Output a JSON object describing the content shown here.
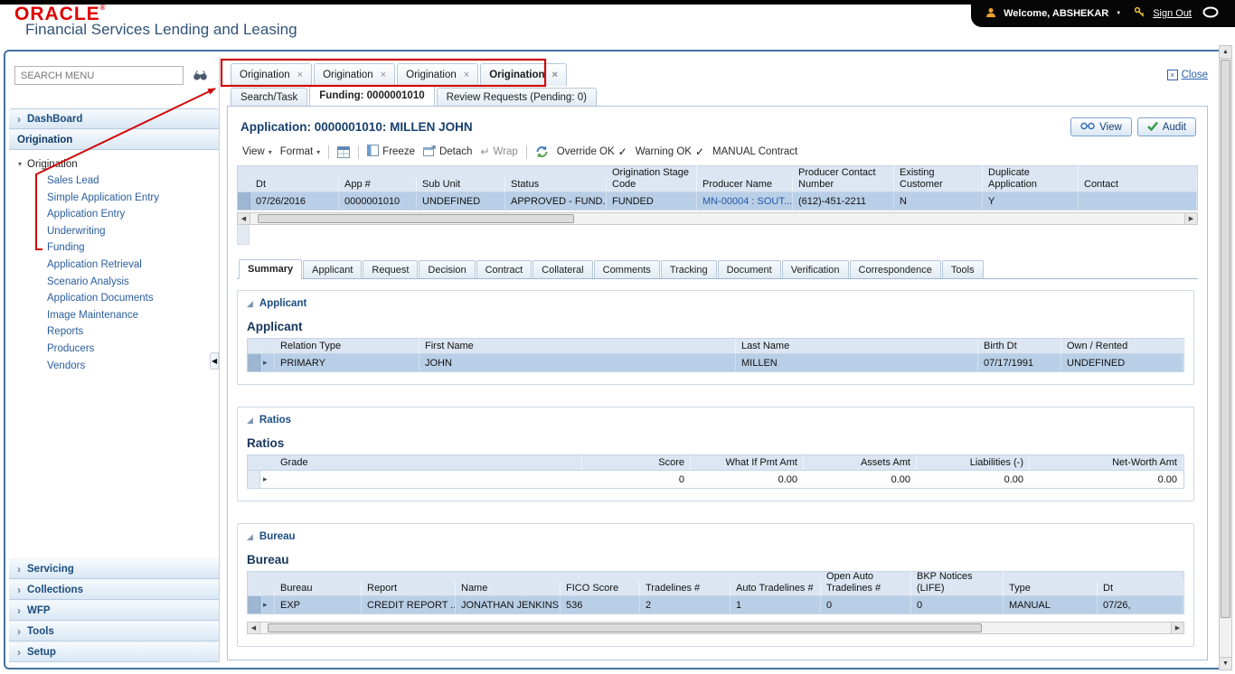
{
  "colors": {
    "oracle_red": "#e00000",
    "title_blue": "#2f5377",
    "frame_blue": "#44719f",
    "selected_row": "#b9cfe7",
    "link_blue": "#2456a8",
    "annotation_red": "#cf0a0a"
  },
  "icons": {
    "close_x": "×",
    "check": "✓",
    "dropdown": "▾",
    "tree_expanded": "▾",
    "row_arrow": "▸",
    "section_disclosure": "◢",
    "up": "▲",
    "down": "▼",
    "left": "◀",
    "right": "▶",
    "wrap": "↵",
    "accordion_chevron": "›"
  },
  "branding": {
    "logo": "ORACLE",
    "registered": "®",
    "app_title": "Financial Services Lending and Leasing"
  },
  "topbar": {
    "welcome": "Welcome, ABSHEKAR",
    "sign_out": "Sign Out"
  },
  "sidebar": {
    "search_placeholder": "SEARCH MENU",
    "dashboard": "DashBoard",
    "origination_header": "Origination",
    "tree_root": "Origination",
    "tree_items": [
      "Sales Lead",
      "Simple Application Entry",
      "Application Entry",
      "Underwriting",
      "Funding",
      "Application Retrieval",
      "Scenario Analysis",
      "Application Documents",
      "Image Maintenance",
      "Reports",
      "Producers",
      "Vendors"
    ],
    "bottom": [
      "Servicing",
      "Collections",
      "WFP",
      "Tools",
      "Setup"
    ]
  },
  "tabs": {
    "top": [
      "Origination",
      "Origination",
      "Origination",
      "Origination"
    ],
    "close": "Close",
    "sub": [
      "Search/Task",
      "Funding: 0000001010",
      "Review Requests (Pending: 0)"
    ]
  },
  "page": {
    "title": "Application: 0000001010: MILLEN JOHN",
    "view": "View",
    "audit": "Audit"
  },
  "toolbar": {
    "view": "View",
    "format": "Format",
    "freeze": "Freeze",
    "detach": "Detach",
    "wrap": "Wrap",
    "override_ok": "Override OK",
    "warning_ok": "Warning OK",
    "manual_contract": "MANUAL Contract"
  },
  "app_grid": {
    "columns": [
      "Dt",
      "App #",
      "Sub Unit",
      "Status",
      "Origination Stage Code",
      "Producer Name",
      "Producer Contact Number",
      "Existing Customer",
      "Duplicate Application",
      "Contact"
    ],
    "row": [
      "07/26/2016",
      "0000001010",
      "UNDEFINED",
      "APPROVED - FUND...",
      "FUNDED",
      "MN-00004 : SOUT...",
      "(612)-451-2211",
      "N",
      "Y",
      ""
    ]
  },
  "subtabs": [
    "Summary",
    "Applicant",
    "Request",
    "Decision",
    "Contract",
    "Collateral",
    "Comments",
    "Tracking",
    "Document",
    "Verification",
    "Correspondence",
    "Tools"
  ],
  "applicant": {
    "section": "Applicant",
    "title": "Applicant",
    "columns": [
      "Relation Type",
      "First Name",
      "Last Name",
      "Birth Dt",
      "Own / Rented"
    ],
    "row": [
      "PRIMARY",
      "JOHN",
      "MILLEN",
      "07/17/1991",
      "UNDEFINED"
    ]
  },
  "ratios": {
    "section": "Ratios",
    "title": "Ratios",
    "columns": [
      "Grade",
      "Score",
      "What If Pmt Amt",
      "Assets Amt",
      "Liabilities (-)",
      "Net-Worth Amt"
    ],
    "row": [
      "",
      "0",
      "0.00",
      "0.00",
      "0.00",
      "0.00"
    ]
  },
  "bureau": {
    "section": "Bureau",
    "title": "Bureau",
    "columns": [
      "Bureau",
      "Report",
      "Name",
      "FICO Score",
      "Tradelines #",
      "Auto Tradelines #",
      "Open Auto Tradelines #",
      "BKP Notices (LIFE)",
      "Type",
      "Dt"
    ],
    "row": [
      "EXP",
      "CREDIT REPORT ...",
      "JONATHAN JENKINS",
      "536",
      "2",
      "1",
      "0",
      "0",
      "MANUAL",
      "07/26,"
    ]
  }
}
